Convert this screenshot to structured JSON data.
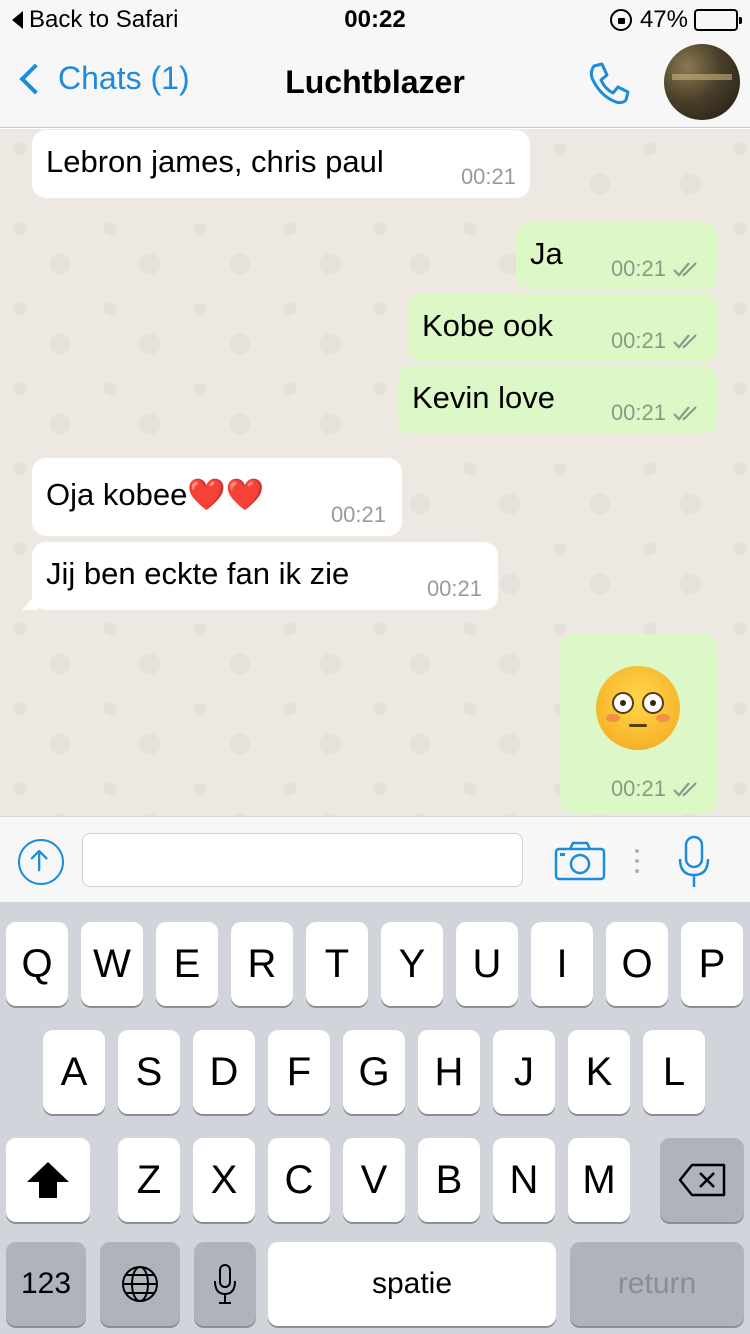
{
  "status_bar": {
    "back_label": "Back to Safari",
    "time": "00:22",
    "battery_percent": "47%",
    "battery_level": 0.47,
    "battery_color": "#ffd60a"
  },
  "nav": {
    "back_label": "Chats (1)",
    "title": "Luchtblazer",
    "accent": "#1d8cdc"
  },
  "messages": [
    {
      "direction": "in",
      "text": "Lebron james, chris paul",
      "time": "00:21"
    },
    {
      "direction": "out",
      "text": "Ja",
      "time": "00:21"
    },
    {
      "direction": "out",
      "text": "Kobe ook",
      "time": "00:21"
    },
    {
      "direction": "out",
      "text": "Kevin love",
      "time": "00:21"
    },
    {
      "direction": "in",
      "text": "Oja kobee❤️❤️",
      "time": "00:21"
    },
    {
      "direction": "in",
      "text": "Jij ben eckte fan ik zie",
      "time": "00:21"
    },
    {
      "direction": "out",
      "emoji": "flushed-face",
      "time": "00:21"
    }
  ],
  "input": {
    "value": ""
  },
  "keyboard": {
    "row1": [
      "Q",
      "W",
      "E",
      "R",
      "T",
      "Y",
      "U",
      "I",
      "O",
      "P"
    ],
    "row2": [
      "A",
      "S",
      "D",
      "F",
      "G",
      "H",
      "J",
      "K",
      "L"
    ],
    "row3": [
      "Z",
      "X",
      "C",
      "V",
      "B",
      "N",
      "M"
    ],
    "numbers_label": "123",
    "space_label": "spatie",
    "return_label": "return"
  },
  "colors": {
    "incoming_bubble": "#ffffff",
    "outgoing_bubble": "#dcf8c6",
    "chat_background": "#ede8e1",
    "keyboard_background": "#d1d5db"
  }
}
